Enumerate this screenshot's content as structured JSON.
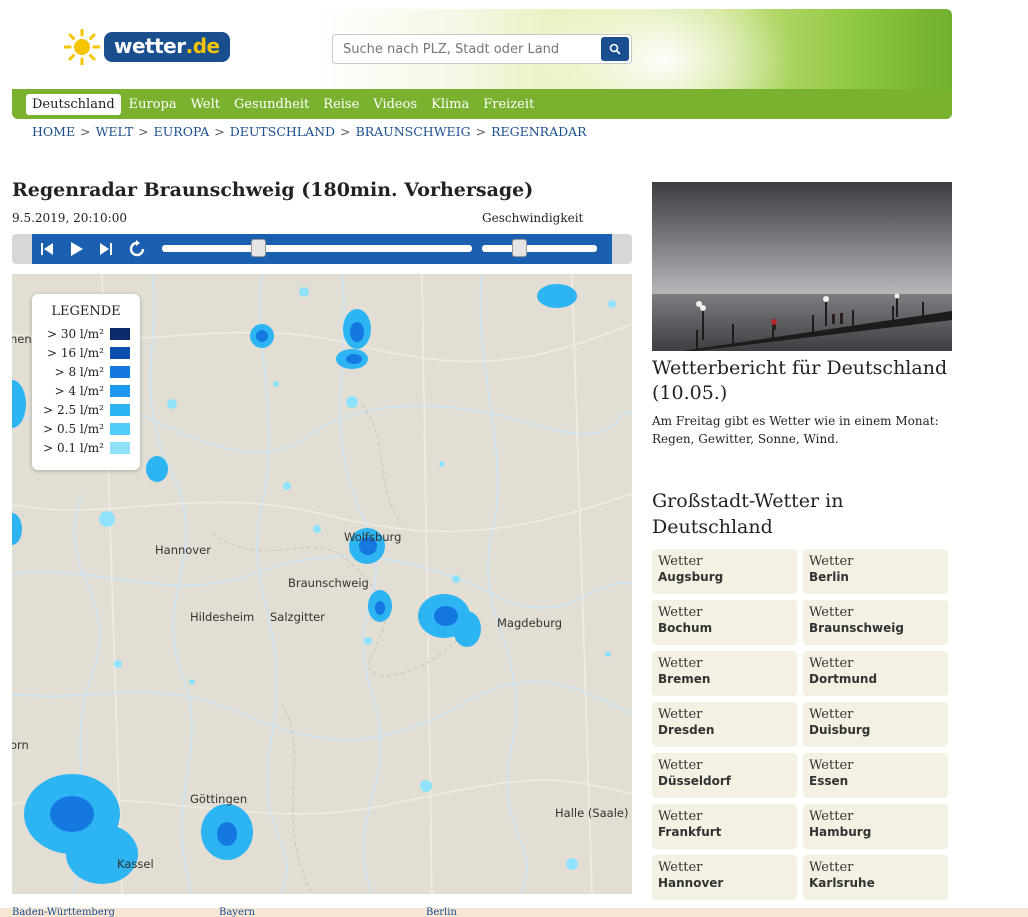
{
  "header": {
    "logo_text": "wetter",
    "logo_suffix": ".de",
    "search_placeholder": "Suche nach PLZ, Stadt oder Land",
    "nav": [
      "Deutschland",
      "Europa",
      "Welt",
      "Gesundheit",
      "Reise",
      "Videos",
      "Klima",
      "Freizeit"
    ],
    "colors": {
      "brand_blue": "#1a4f8f",
      "nav_green": "#7ab230",
      "sun_yellow": "#f5c400"
    }
  },
  "breadcrumb": [
    "HOME",
    "WELT",
    "EUROPA",
    "DEUTSCHLAND",
    "BRAUNSCHWEIG",
    "REGENRADAR"
  ],
  "breadcrumb_separator": ">",
  "radar": {
    "title_prefix": "Regenradar Braunschweig ",
    "title_bold": "(180min. Vorhersage)",
    "timestamp": "9.5.2019, 20:10:00",
    "speed_label": "Geschwindigkeit",
    "progress": 0.3,
    "speed": 0.3
  },
  "legend": {
    "title": "LEGENDE",
    "items": [
      {
        "label": "> 30 l/m²",
        "color": "#0a2a6b"
      },
      {
        "label": "> 16 l/m²",
        "color": "#0d4fae"
      },
      {
        "label": "> 8 l/m²",
        "color": "#1478e0"
      },
      {
        "label": "> 4 l/m²",
        "color": "#1c99ee"
      },
      {
        "label": "> 2.5 l/m²",
        "color": "#2db4f2"
      },
      {
        "label": "> 0.5 l/m²",
        "color": "#50cdf6"
      },
      {
        "label": "> 0.1 l/m²",
        "color": "#8fe2fa"
      }
    ]
  },
  "map_cities": {
    "hannover": "Hannover",
    "braunschweig": "Braunschweig",
    "wolfsburg": "Wolfsburg",
    "hildesheim": "Hildesheim",
    "salzgitter": "Salzgitter",
    "magdeburg": "Magdeburg",
    "goettingen": "Göttingen",
    "kassel": "Kassel",
    "halle": "Halle (Saale)",
    "edge_left_1": "nen",
    "edge_left_2": "orn"
  },
  "bottom_links": [
    "Baden-Württemberg",
    "Bayern",
    "Berlin"
  ],
  "article": {
    "title": "Wetterbericht für Deutschland (10.05.)",
    "text": "Am Freitag gibt es Wetter wie in einem Monat: Regen, Gewitter, Sonne, Wind."
  },
  "cities_section": {
    "title": "Großstadt-Wetter in Deutschland",
    "prefix": "Wetter",
    "cities": [
      "Augsburg",
      "Berlin",
      "Bochum",
      "Braunschweig",
      "Bremen",
      "Dortmund",
      "Dresden",
      "Duisburg",
      "Düsseldorf",
      "Essen",
      "Frankfurt",
      "Hamburg",
      "Hannover",
      "Karlsruhe"
    ]
  }
}
